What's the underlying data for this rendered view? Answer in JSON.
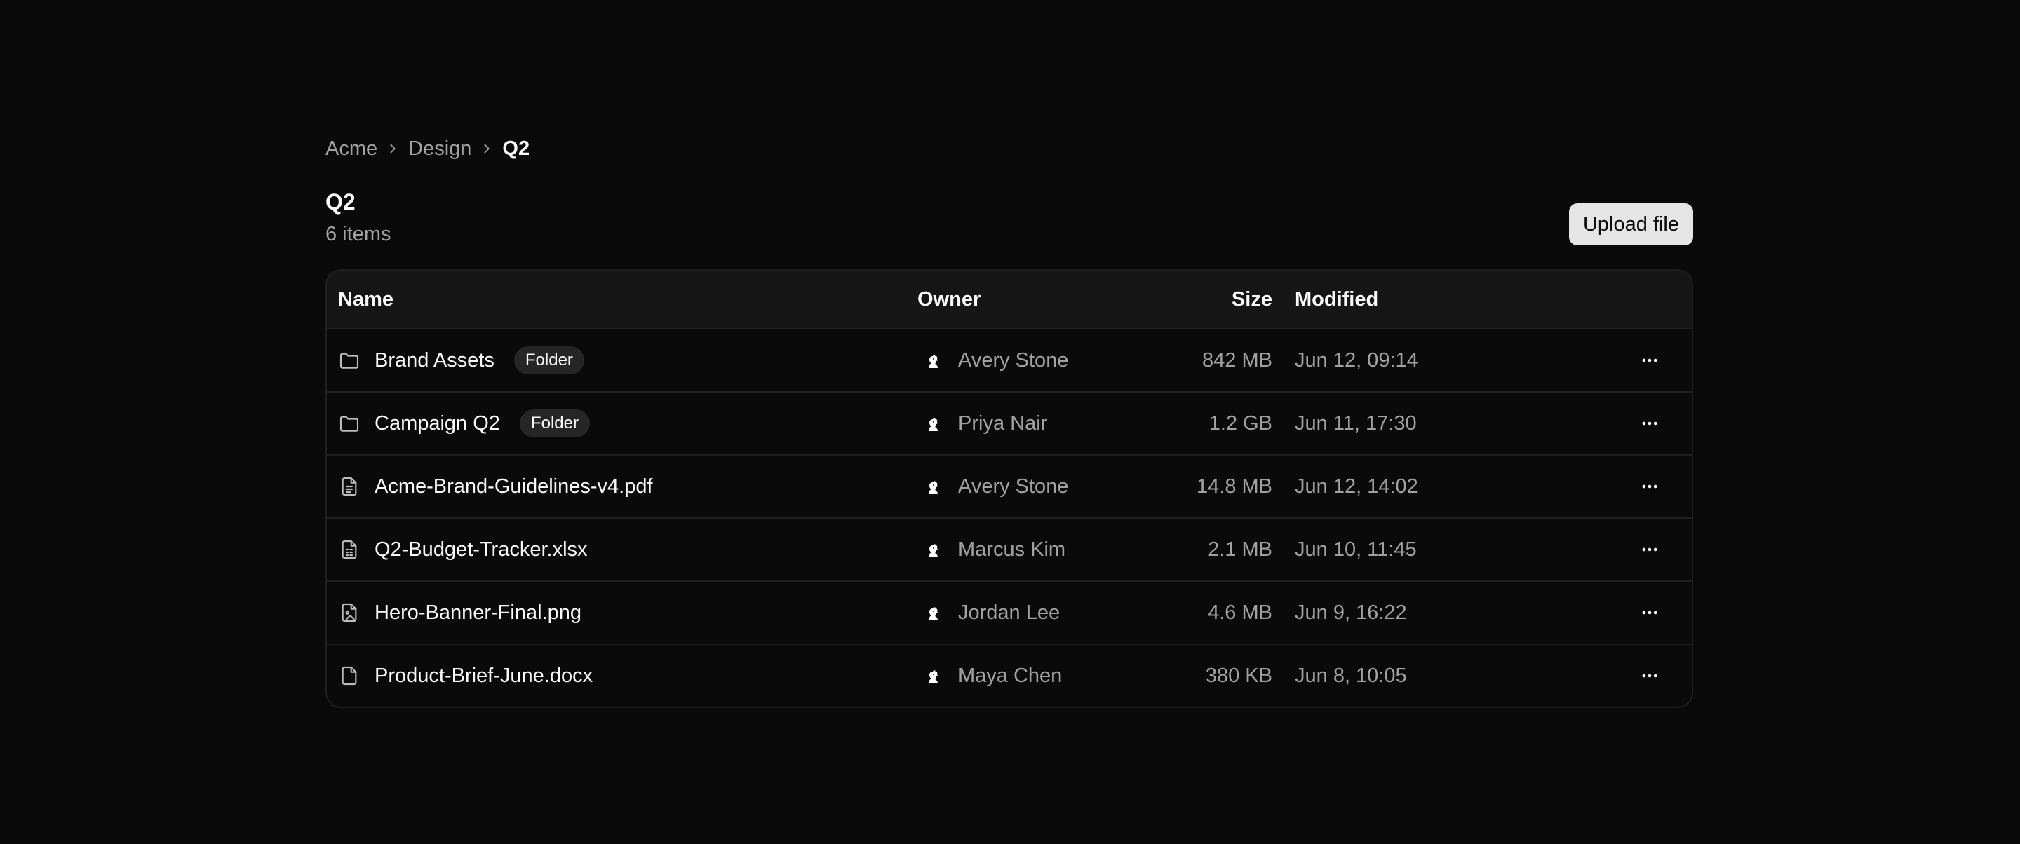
{
  "breadcrumb": {
    "items": [
      "Acme",
      "Design"
    ],
    "current": "Q2"
  },
  "header": {
    "title": "Q2",
    "subtitle": "6 items",
    "upload_label": "Upload file"
  },
  "table": {
    "columns": {
      "name": "Name",
      "owner": "Owner",
      "size": "Size",
      "modified": "Modified"
    },
    "rows": [
      {
        "icon": "folder-icon",
        "name": "Brand Assets",
        "badge": "Folder",
        "owner": "Avery Stone",
        "size": "842 MB",
        "modified": "Jun 12, 09:14"
      },
      {
        "icon": "folder-icon",
        "name": "Campaign Q2",
        "badge": "Folder",
        "owner": "Priya Nair",
        "size": "1.2 GB",
        "modified": "Jun 11, 17:30"
      },
      {
        "icon": "pdf-file-icon",
        "name": "Acme-Brand-Guidelines-v4.pdf",
        "badge": "",
        "owner": "Avery Stone",
        "size": "14.8 MB",
        "modified": "Jun 12, 14:02"
      },
      {
        "icon": "spreadsheet-file-icon",
        "name": "Q2-Budget-Tracker.xlsx",
        "badge": "",
        "owner": "Marcus Kim",
        "size": "2.1 MB",
        "modified": "Jun 10, 11:45"
      },
      {
        "icon": "image-file-icon",
        "name": "Hero-Banner-Final.png",
        "badge": "",
        "owner": "Jordan Lee",
        "size": "4.6 MB",
        "modified": "Jun 9, 16:22"
      },
      {
        "icon": "document-file-icon",
        "name": "Product-Brief-June.docx",
        "badge": "",
        "owner": "Maya Chen",
        "size": "380 KB",
        "modified": "Jun 8, 10:05"
      }
    ]
  },
  "colors": {
    "background": "#0a0a0a",
    "surface": "#161616",
    "border": "#1f1f1f",
    "muted_text": "#a1a1a1",
    "primary_button": "#e5e5e5"
  }
}
